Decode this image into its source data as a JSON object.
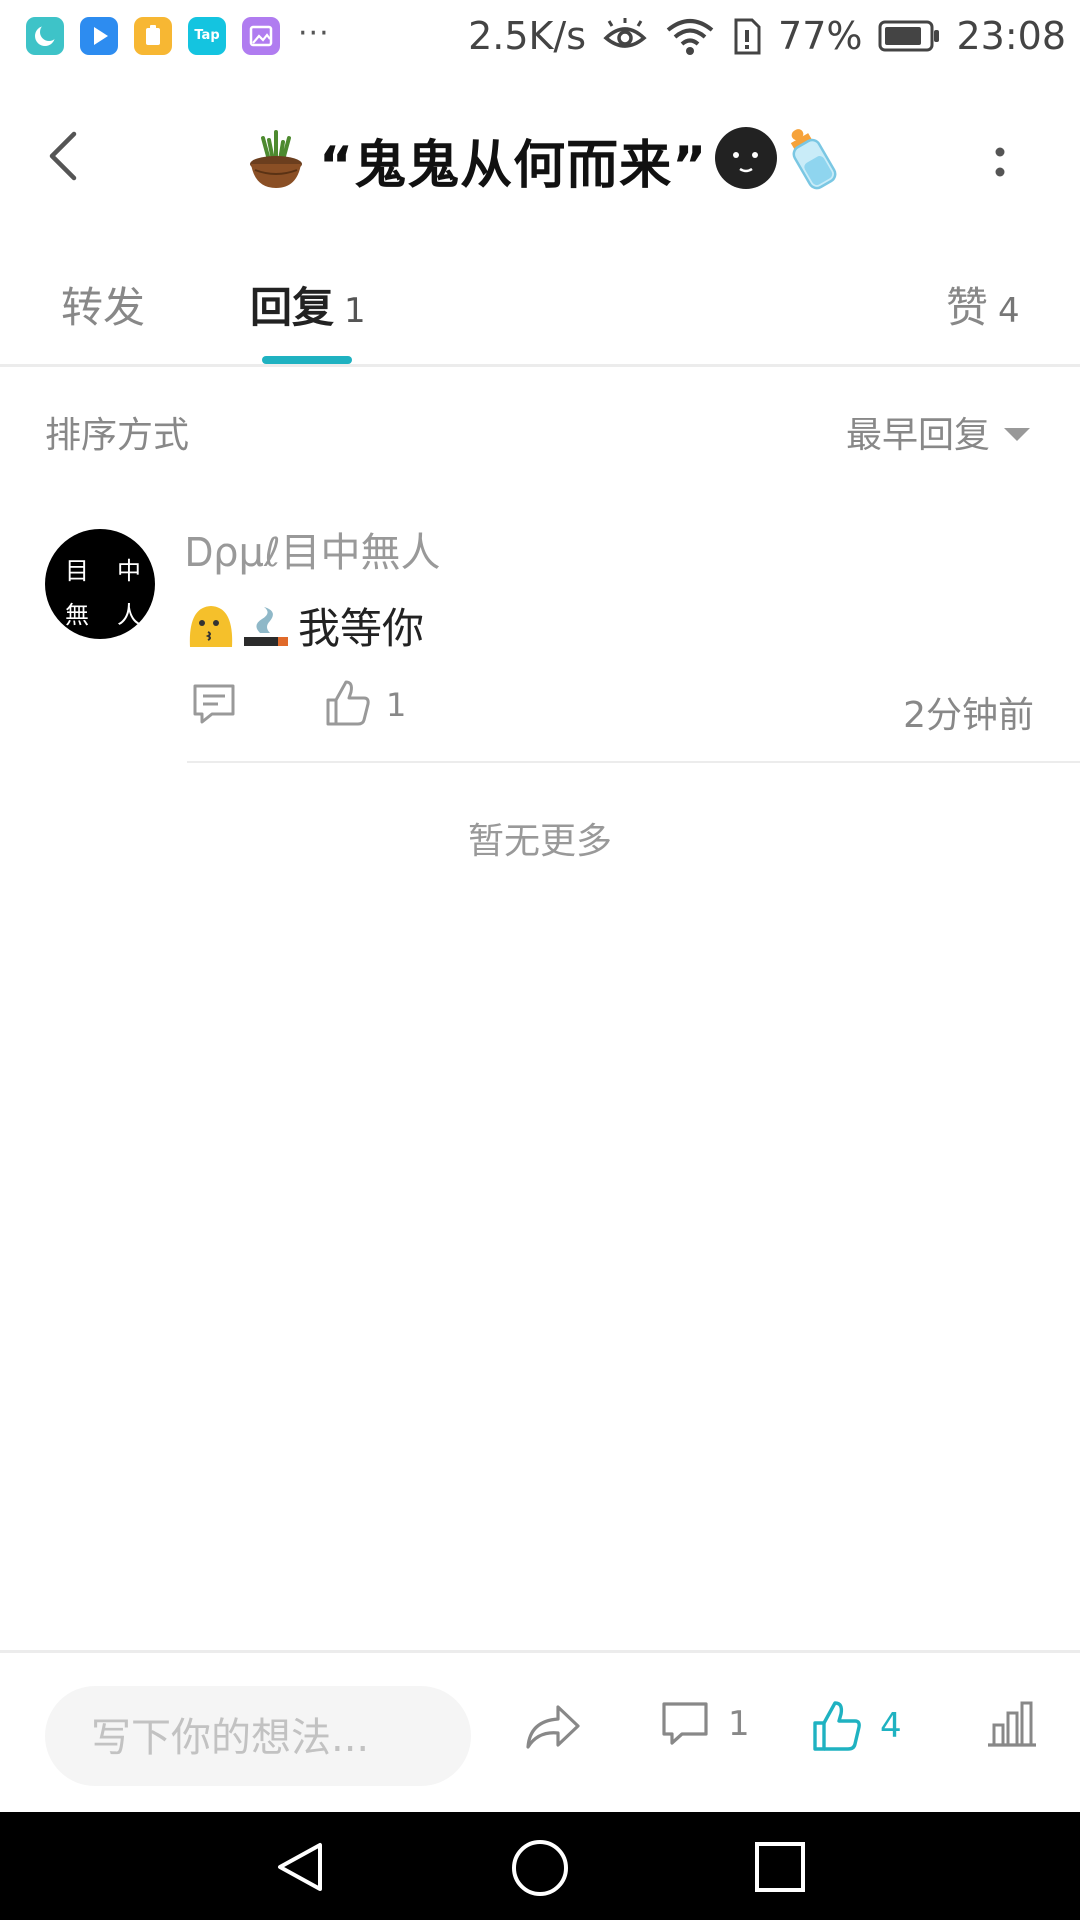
{
  "status_bar": {
    "app_icons": [
      "moon-app-icon",
      "video-play-app-icon",
      "yellow-app-icon",
      "taptap-app-icon",
      "gallery-app-icon"
    ],
    "taptap_label": "Tap",
    "overflow": "···",
    "net_speed": "2.5K/s",
    "battery_percent": "77%",
    "time": "23:08"
  },
  "header": {
    "title": "“鬼鬼从何而来”",
    "title_emojis": [
      "potted-plant-emoji",
      "black-moon-face-emoji",
      "baby-bottle-emoji"
    ]
  },
  "tabs": [
    {
      "label": "转发",
      "count": ""
    },
    {
      "label": "回复",
      "count": "1",
      "active": true
    },
    {
      "label": "赞",
      "count": "4"
    }
  ],
  "sort": {
    "label": "排序方式",
    "selected": "最早回复"
  },
  "comment": {
    "avatar_chars": [
      "目",
      "中",
      "無",
      "人"
    ],
    "username": "Ꭰρμℓ目中無人",
    "emojis": [
      "kissing-face-emoji",
      "smoking-emoji"
    ],
    "text": "我等你",
    "like_count": "1",
    "time": "2分钟前"
  },
  "no_more": "暂无更多",
  "bottom_bar": {
    "input_placeholder": "写下你的想法...",
    "comment_count": "1",
    "like_count": "4"
  },
  "colors": {
    "accent": "#1fb2c1",
    "muted_text": "#888888",
    "divider": "#ececec"
  }
}
